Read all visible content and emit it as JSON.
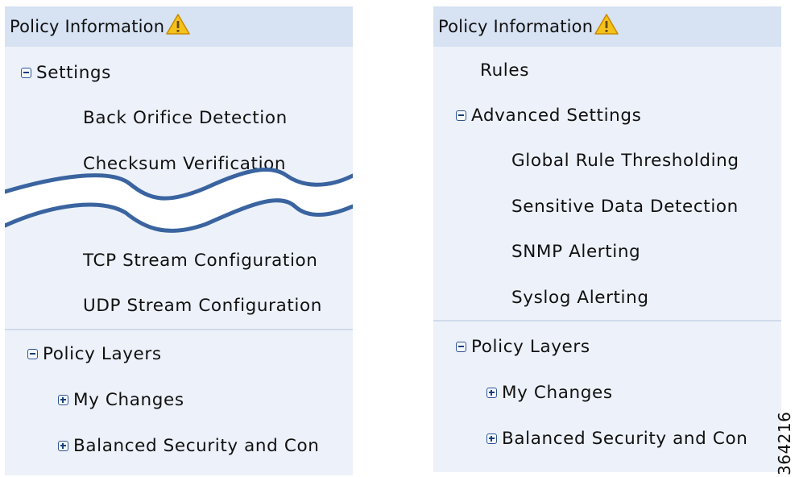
{
  "left_panel": {
    "header": "Policy Information",
    "settings": {
      "label": "Settings",
      "items": [
        "Back Orifice Detection",
        "Checksum Verification",
        "TCP Stream Configuration",
        "UDP Stream Configuration"
      ]
    },
    "policy_layers": {
      "label": "Policy Layers",
      "items": [
        "My Changes",
        "Balanced Security and Con"
      ]
    }
  },
  "right_panel": {
    "header": "Policy Information",
    "rules": "Rules",
    "advanced_settings": {
      "label": "Advanced Settings",
      "items": [
        "Global Rule Thresholding",
        "Sensitive Data Detection",
        "SNMP Alerting",
        "Syslog Alerting"
      ]
    },
    "policy_layers": {
      "label": "Policy Layers",
      "items": [
        "My Changes",
        "Balanced Security and Con"
      ]
    }
  },
  "figure_number": "364216",
  "colors": {
    "panel_bg": "#edf1f9",
    "header_bg": "#d7e2f3",
    "toggle_border": "#2f5597",
    "break_line": "#3a64a0",
    "warning_fill": "#f5c21b"
  },
  "icons": {
    "warning": "warning-triangle-icon",
    "collapse": "minus-box-icon",
    "expand": "plus-box-icon"
  }
}
